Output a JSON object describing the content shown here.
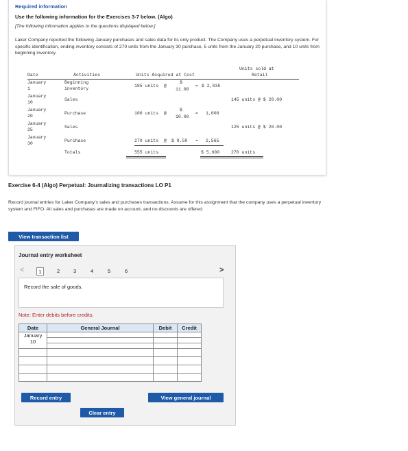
{
  "info": {
    "required_title": "Required information",
    "use_line": "Use the following information for the Exercises 3-7 below. (Algo)",
    "italic_line": "[The following information applies to the questions displayed below.]",
    "paragraph": "Laker Company reported the following January purchases and sales data for its only product. The Company uses a perpetual inventory system. For specific identification, ending inventory consists of 270 units from the January 30 purchase, 5 units from the January 20 purchase, and 10 units from beginning inventory."
  },
  "inventory_table": {
    "headers": {
      "date": "Date",
      "activities": "Activities",
      "acquired": "Units Acquired at Cost",
      "sold_line1": "Units sold at",
      "sold_line2": "Retail"
    },
    "rows": [
      {
        "date_1": "January",
        "date_2": "1",
        "activity_1": "Beginning",
        "activity_2": "inventory",
        "units": "185 units",
        "at": "@",
        "cost_top": "$",
        "cost_bottom": "11.00",
        "eq": "=",
        "total": "$ 2,035",
        "sold": ""
      },
      {
        "date_1": "January",
        "date_2": "10",
        "activity_1": "Sales",
        "activity_2": "",
        "units": "",
        "at": "",
        "cost_top": "",
        "cost_bottom": "",
        "eq": "",
        "total": "",
        "sold": "145 units @ $ 20.00"
      },
      {
        "date_1": "January",
        "date_2": "20",
        "activity_1": "Purchase",
        "activity_2": "",
        "units": "100 units",
        "at": "@",
        "cost_top": "$",
        "cost_bottom": "10.00",
        "eq": "=",
        "total": "1,000",
        "sold": ""
      },
      {
        "date_1": "January",
        "date_2": "25",
        "activity_1": "Sales",
        "activity_2": "",
        "units": "",
        "at": "",
        "cost_top": "",
        "cost_bottom": "",
        "eq": "",
        "total": "",
        "sold": "125 units @ $ 20.00"
      },
      {
        "date_1": "January",
        "date_2": "30",
        "activity_1": "Purchase",
        "activity_2": "",
        "units": "270 units",
        "at": "@",
        "cost_top": "$ 9.50",
        "cost_bottom": "",
        "eq": "=",
        "total": "2,565",
        "sold": ""
      }
    ],
    "totals": {
      "label": "Totals",
      "units": "555 units",
      "total": "$ 5,600",
      "sold": "270 units"
    }
  },
  "exercise": {
    "title": "Exercise 6-4 (Algo) Perpetual: Journalizing transactions LO P1",
    "paragraph": "Record journal entries for Laker Company's sales and purchases transactions. Assume for this assignment that the company uses a perpetual inventory system and FIFO. All sales and purchases are made on account, and no discounts are offered.",
    "view_transactions_label": "View transaction list"
  },
  "worksheet": {
    "title": "Journal entry worksheet",
    "prev_icon": "chevron-left-icon",
    "next_icon": "chevron-right-icon",
    "prev_glyph": "<",
    "next_glyph": ">",
    "pages": [
      "1",
      "2",
      "3",
      "4",
      "5",
      "6"
    ],
    "active_page": "1",
    "description": "Record the sale of goods.",
    "note": "Note: Enter debits before credits.",
    "table_headers": {
      "date": "Date",
      "general_journal": "General Journal",
      "debit": "Debit",
      "credit": "Credit"
    },
    "entry_date_1": "January",
    "entry_date_2": "10",
    "record_entry_label": "Record entry",
    "clear_entry_label": "Clear entry",
    "view_general_journal_label": "View general journal"
  },
  "colors": {
    "accent": "#1e5aa8",
    "note_red": "#b22222",
    "header_blue": "#dbe7f5"
  }
}
